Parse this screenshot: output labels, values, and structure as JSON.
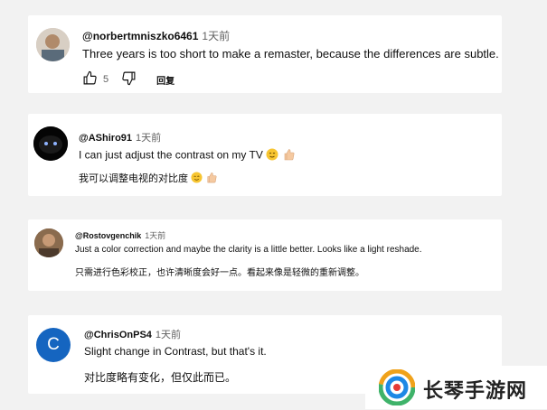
{
  "comments": [
    {
      "handle": "@norbertmniszko6461",
      "time": "1天前",
      "lines": [
        "Three years is too short to make a remaster, because the differences are subtle."
      ],
      "likes": "5",
      "reply_label": "回复"
    },
    {
      "handle": "@AShiro91",
      "time": "1天前",
      "lines": [
        "I can just adjust the contrast on my TV",
        "我可以调整电视的对比度"
      ]
    },
    {
      "handle": "@Rostovgenchik",
      "time": "1天前",
      "lines": [
        "Just a color correction and maybe the clarity is a little better.  Looks like a light reshade.",
        "只需进行色彩校正，也许清晰度会好一点。看起来像是轻微的重新调整。"
      ]
    },
    {
      "handle": "@ChrisOnPS4",
      "time": "1天前",
      "avatar_letter": "C",
      "lines": [
        "Slight change in Contrast, but that's it.",
        "对比度略有变化，但仅此而已。"
      ]
    }
  ],
  "watermark": {
    "text": "长琴手游网"
  },
  "colors": {
    "avatar_chris": "#1565c0",
    "background": "#f2f2f2"
  }
}
